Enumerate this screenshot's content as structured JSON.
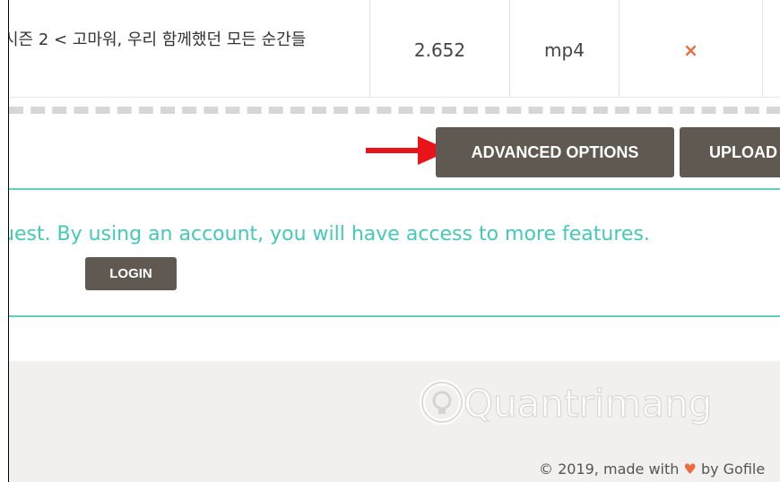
{
  "file_table": {
    "row": {
      "name": "시즌 2 < 고마워, 우리 함께했던 모든 순간들",
      "size": "2.652",
      "type": "mp4",
      "delete_symbol": "×"
    }
  },
  "actions": {
    "advanced_options_label": "ADVANCED OPTIONS",
    "upload_label": "UPLOAD"
  },
  "guest_notice": {
    "text": "uest. By using an account, you will have access to more features.",
    "login_label": "LOGIN"
  },
  "footer": {
    "watermark": "Quantrimang",
    "copyright_prefix": "© 2019, made with",
    "heart_symbol": "♥",
    "copyright_suffix": "by Gofile"
  },
  "colors": {
    "button_bg": "#5f5952",
    "teal": "#5fcfc1",
    "teal_text": "#45c8b8",
    "delete_red": "#e86c3c",
    "arrow_red": "#e8141a"
  }
}
